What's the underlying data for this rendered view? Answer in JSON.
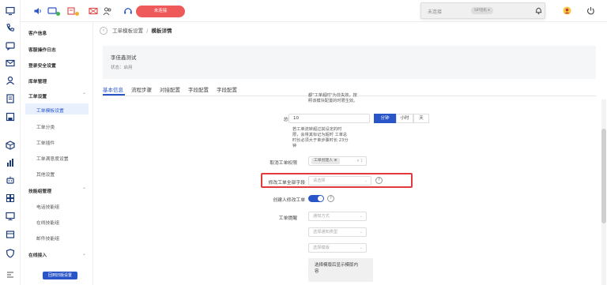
{
  "topbar": {
    "status_button": "未连接",
    "status_panel_text": "未连接",
    "status_panel_switch": "SIP话机 ▾"
  },
  "sidebar": {
    "items": [
      {
        "label": "客户信息"
      },
      {
        "label": "客服操作日志"
      },
      {
        "label": "登录安全设置"
      },
      {
        "label": "库单管理"
      },
      {
        "label": "工单设置",
        "chevron": "⌃"
      },
      {
        "label": "工单模板设置",
        "active": true
      },
      {
        "label": "工单分类"
      },
      {
        "label": "工单插件"
      },
      {
        "label": "工单满意度设置"
      },
      {
        "label": "其他设置"
      },
      {
        "label": "技能组管理",
        "chevron": "⌃"
      },
      {
        "label": "电话技能组"
      },
      {
        "label": "在线技能组"
      },
      {
        "label": "邮件技能组"
      },
      {
        "label": "在线接入",
        "chevron": "⌄"
      }
    ],
    "bottom_button": "回到旧版设置"
  },
  "breadcrumb": {
    "back_icon": "‹",
    "parent": "工单模板设置",
    "separator": "/",
    "current": "模板详情"
  },
  "card": {
    "name": "李佳鑫测试",
    "status": "状态：启用"
  },
  "tabs": [
    {
      "label": "基本信息",
      "active": true
    },
    {
      "label": "流程步骤"
    },
    {
      "label": "对接配置"
    },
    {
      "label": "字段配置"
    },
    {
      "label": "字段配置"
    }
  ],
  "form": {
    "note_top_1": "都\"工单超时\"为非失效，按",
    "note_top_2": "照该模块配置的时限生效。",
    "timeout_label": "总时限",
    "timeout_value": "10",
    "units": [
      "分钟",
      "小时",
      "天"
    ],
    "note_mid_1": "若工单流转超过其设定的时",
    "note_mid_2": "限，会将其标记为超时 工单总",
    "note_mid_3": "时长必须大于单步骤时长 23分",
    "note_mid_4": "钟",
    "cancel_notify_label": "取消工单权限",
    "cancel_notify_tag": "工单创建人 ⊗",
    "cancel_notify_arrow": "▾ 1",
    "modify_fields_label": "修改工单全部字段",
    "modify_fields_placeholder": "请选择",
    "help_glyph": "?",
    "creator_modify_label": "创建人修改工单",
    "reminder_label": "工单提醒",
    "reminder_select_1": "通知方式",
    "reminder_select_2": "选择通知类型",
    "reminder_select_3": "选择模版",
    "template_box_text_1": "选择模版后显示模版内",
    "template_box_text_2": "容",
    "arrow_glyph": "⌄"
  }
}
